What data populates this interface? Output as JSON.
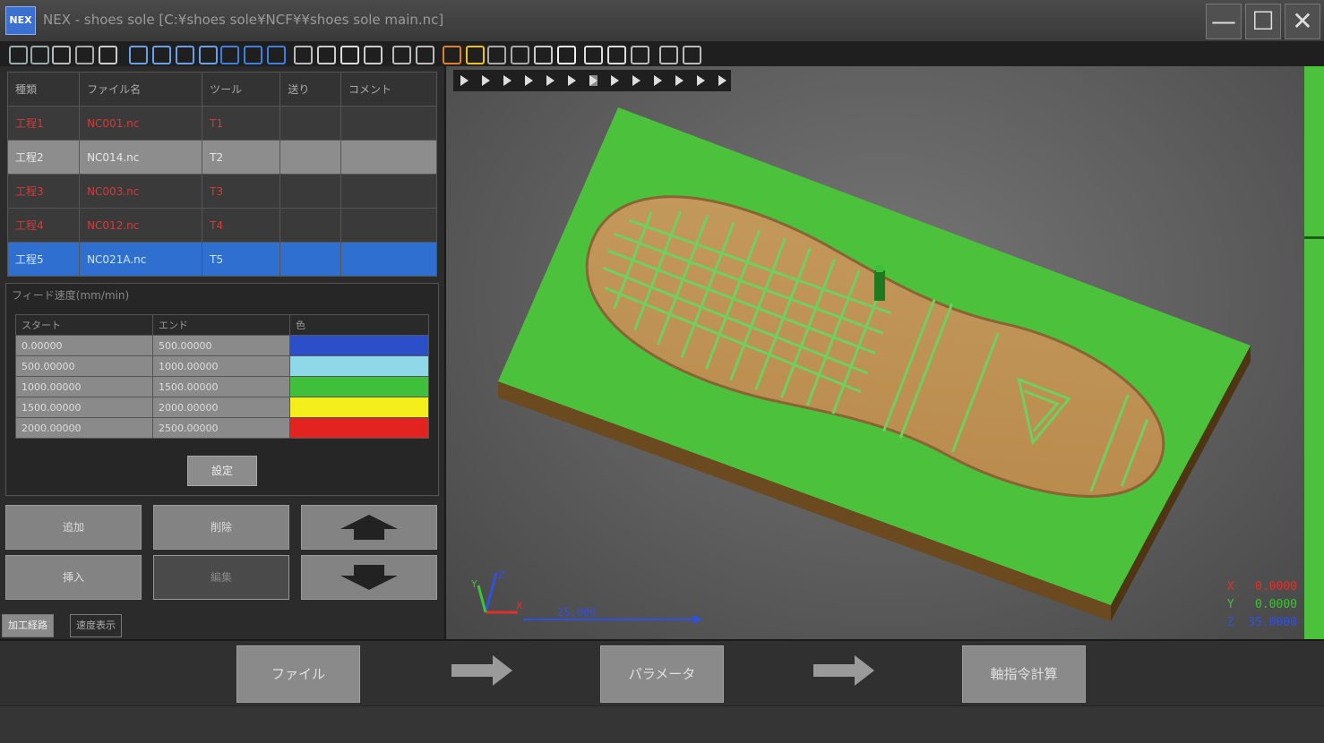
{
  "window": {
    "title": "NEX - shoes sole [C:¥shoes sole¥NCF¥¥shoes sole main.nc]",
    "icon_label": "NEX",
    "buttons": [
      "minimize",
      "maximize",
      "close"
    ]
  },
  "toolbar": {
    "icons": [
      "zoom-in-icon",
      "zoom-out-icon",
      "zoom-window-icon",
      "rotate-icon",
      "pan-icon",
      "view-front-icon",
      "view-back-icon",
      "view-left-icon",
      "view-right-icon",
      "view-top-icon",
      "view-bottom-icon",
      "view-iso-icon",
      "measure-icon",
      "section-icon",
      "shade-icon",
      "wire-icon",
      "save-icon",
      "tool-icon",
      "stock-icon",
      "cube-icon",
      "path-icon",
      "arc-icon",
      "rect-icon",
      "cutter-icon",
      "settings-icon",
      "sphere-icon",
      "undo-icon",
      "info-icon",
      "help-icon"
    ]
  },
  "process_table": {
    "headers": [
      "種類",
      "ファイル名",
      "ツール",
      "送り",
      "コメント"
    ],
    "rows": [
      {
        "type": "工程1",
        "file": "NC001.nc",
        "tool": "T1",
        "feed": "",
        "comment": "",
        "style": "red"
      },
      {
        "type": "工程2",
        "file": "NC014.nc",
        "tool": "T2",
        "feed": "",
        "comment": "",
        "style": "gray"
      },
      {
        "type": "工程3",
        "file": "NC003.nc",
        "tool": "T3",
        "feed": "",
        "comment": "",
        "style": "red"
      },
      {
        "type": "工程4",
        "file": "NC012.nc",
        "tool": "T4",
        "feed": "",
        "comment": "",
        "style": "red"
      },
      {
        "type": "工程5",
        "file": "NC021A.nc",
        "tool": "T5",
        "feed": "",
        "comment": "",
        "style": "selected"
      }
    ]
  },
  "feed_panel": {
    "title": "フィード速度(mm/min)",
    "headers": [
      "スタート",
      "エンド",
      "色"
    ],
    "rows": [
      {
        "start": "0.00000",
        "end": "500.00000",
        "color": "#2a4fc9"
      },
      {
        "start": "500.00000",
        "end": "1000.00000",
        "color": "#8fd8e8"
      },
      {
        "start": "1000.00000",
        "end": "1500.00000",
        "color": "#3fbf3a"
      },
      {
        "start": "1500.00000",
        "end": "2000.00000",
        "color": "#f4ee1c"
      },
      {
        "start": "2000.00000",
        "end": "2500.00000",
        "color": "#e2231f"
      }
    ],
    "set_button": "設定"
  },
  "process_buttons": {
    "add": "追加",
    "delete": "削除",
    "insert": "挿入",
    "edit": "編集",
    "move_up": "up-arrow-icon",
    "move_down": "down-arrow-icon"
  },
  "tabs": [
    "加工経路",
    "速度表示"
  ],
  "view_toolbar": {
    "icons": [
      "play-icon",
      "step-back-icon",
      "stop-icon",
      "pause-icon",
      "step-forward-icon",
      "fast-forward-icon",
      "layer-icon",
      "rewind-icon",
      "forward-icon",
      "prev-icon",
      "next-icon",
      "end-icon",
      "loop-icon"
    ]
  },
  "viewport": {
    "scale_label": "25.000",
    "axis_labels": [
      "Z",
      "X",
      "Y"
    ],
    "coords": [
      {
        "axis": "X",
        "value": "0.0000",
        "color": "#e0302a"
      },
      {
        "axis": "Y",
        "value": "0.0000",
        "color": "#3fc23a"
      },
      {
        "axis": "Z",
        "value": "35.0000",
        "color": "#3050e0"
      }
    ]
  },
  "flow": {
    "step1": "ファイル",
    "step2": "パラメータ",
    "step3": "軸指令計算"
  },
  "colors": {
    "model_base": "#4cc23c",
    "model_sole": "#c89a5a",
    "selection": "#2e6fcf"
  }
}
